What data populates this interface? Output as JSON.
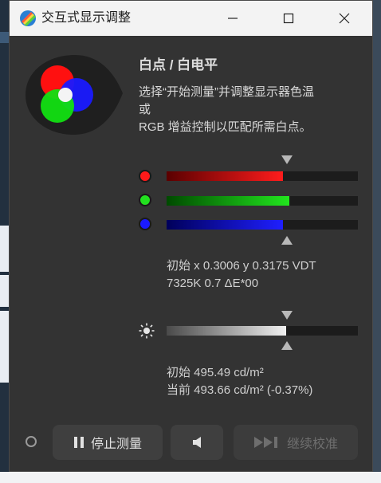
{
  "window": {
    "title": "交互式显示调整"
  },
  "panel": {
    "heading": "白点 / 白电平",
    "instruction_line1": "选择“开始测量”并调整显示器色温",
    "instruction_line2": "或",
    "instruction_line3": "RGB 增益控制以匹配所需白点。"
  },
  "rgb": {
    "channels": [
      {
        "name": "red",
        "color": "#ff1a1a",
        "gradient": [
          "#5a0000",
          "#ff1c1c"
        ],
        "level": 0.61
      },
      {
        "name": "green",
        "color": "#22e01f",
        "gradient": [
          "#004a00",
          "#22e61e"
        ],
        "level": 0.64
      },
      {
        "name": "blue",
        "color": "#1a1aff",
        "gradient": [
          "#00005a",
          "#1f1fff"
        ],
        "level": 0.61
      }
    ],
    "initial_line": "初始 x 0.3006 y 0.3175 VDT",
    "result_line": "7325K 0.7 ΔE*00"
  },
  "brightness": {
    "level": 0.625,
    "initial_line": "初始 495.49 cd/m²",
    "current_line": "当前 493.66 cd/m² (-0.37%)"
  },
  "buttons": {
    "stop_label": "停止测量",
    "stop_icon": "pause-icon",
    "sound_icon": "speaker-icon",
    "next_label": "继续校准",
    "next_icon": "skip-forward-icon"
  }
}
